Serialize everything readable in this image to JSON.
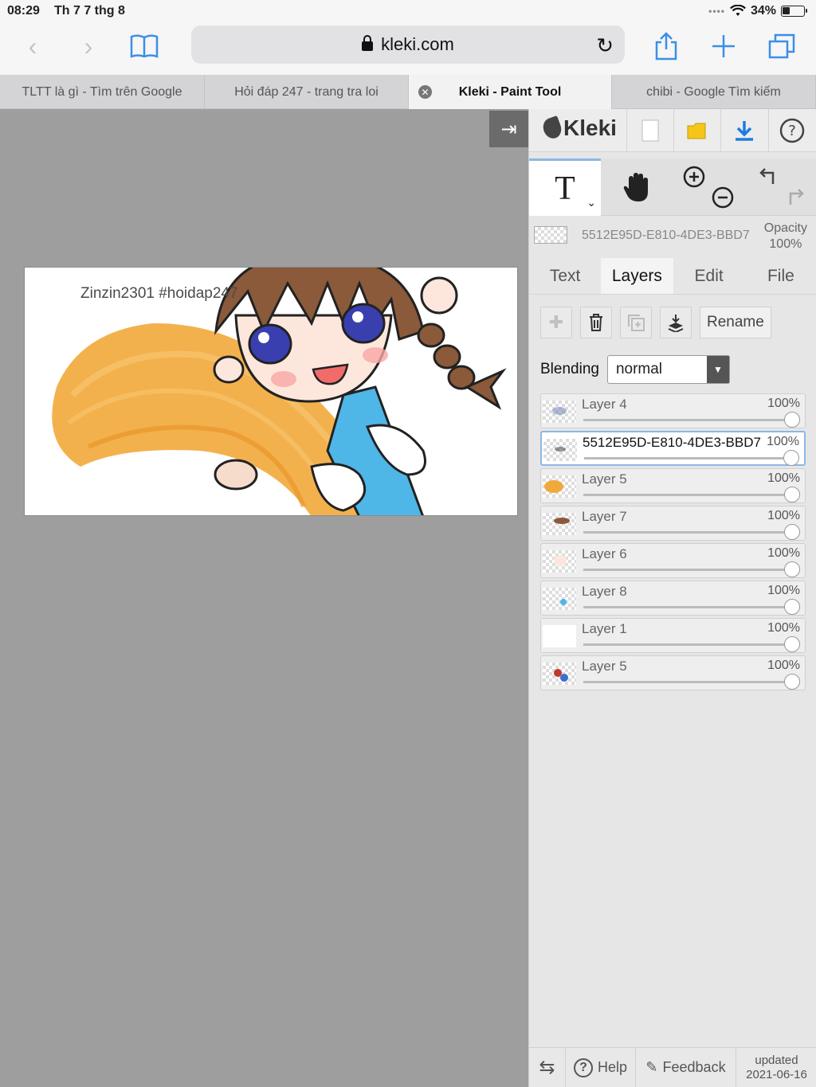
{
  "status": {
    "time": "08:29",
    "date": "Th 7 7 thg 8",
    "battery": "34%",
    "battery_level": 0.34
  },
  "browser": {
    "url": "kleki.com",
    "tabs": [
      {
        "label": "TLTT là gì - Tìm trên Google",
        "active": false
      },
      {
        "label": "Hỏi đáp 247 - trang tra loi",
        "active": false
      },
      {
        "label": "Kleki - Paint Tool",
        "active": true
      },
      {
        "label": "chibi - Google Tìm kiếm",
        "active": false
      }
    ]
  },
  "canvas": {
    "watermark": "Zinzin2301 #hoidap247"
  },
  "panel": {
    "brand": "Kleki",
    "current_layer_name": "5512E95D-E810-4DE3-BBD7",
    "opacity_label": "Opacity",
    "opacity_value": "100%",
    "subtabs": [
      "Text",
      "Layers",
      "Edit",
      "File"
    ],
    "active_subtab": "Layers",
    "rename_label": "Rename",
    "blending_label": "Blending",
    "blending_value": "normal",
    "layers": [
      {
        "name": "Layer 4",
        "opacity": "100%",
        "selected": false
      },
      {
        "name": "5512E95D-E810-4DE3-BBD7",
        "opacity": "100%",
        "selected": true
      },
      {
        "name": "Layer 5",
        "opacity": "100%",
        "selected": false
      },
      {
        "name": "Layer 7",
        "opacity": "100%",
        "selected": false
      },
      {
        "name": "Layer 6",
        "opacity": "100%",
        "selected": false
      },
      {
        "name": "Layer 8",
        "opacity": "100%",
        "selected": false
      },
      {
        "name": "Layer 1",
        "opacity": "100%",
        "selected": false
      },
      {
        "name": "Layer 5",
        "opacity": "100%",
        "selected": false
      }
    ],
    "footer": {
      "help_label": "Help",
      "feedback_label": "Feedback",
      "updated_label": "updated",
      "updated_date": "2021-06-16"
    }
  },
  "colors": {
    "accent": "#3a8fe8",
    "selected_border": "#8cb7e6",
    "canvas_bg": "#9e9e9e",
    "panel_bg": "#e6e6e6"
  }
}
